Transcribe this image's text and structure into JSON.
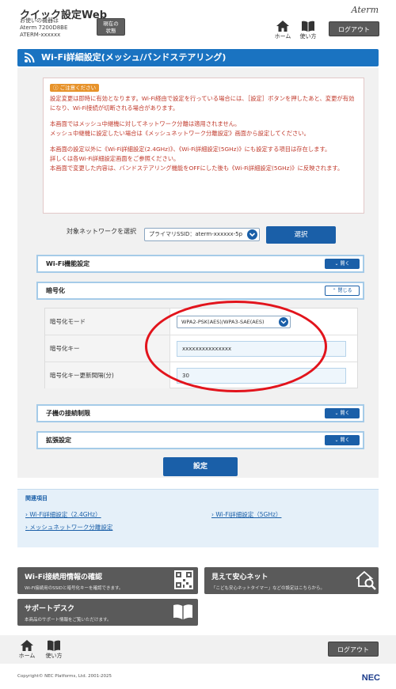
{
  "header": {
    "app_title": "クイック設定Web",
    "device_line1": "お使いの機器は",
    "device_line2": "Aterm 7200D8BE",
    "device_line3": "ATERM-xxxxxx",
    "status_button_line1": "現在の",
    "status_button_line2": "状態",
    "brand": "Aterm",
    "home_label": "ホーム",
    "manual_label": "使い方",
    "logout_label": "ログアウト"
  },
  "page_title": "Wi-Fi詳細設定(メッシュ/バンドステアリング)",
  "notice": {
    "badge": "ご注意ください",
    "p1": "設定変更は即時に有効となります。Wi-Fi経由で設定を行っている場合には、［設定］ボタンを押したあと、変更が有効になり、Wi-Fi接続が切断される場合があります。",
    "p2a": "本画面ではメッシュ中継機に対してネットワーク分離は適用されません。",
    "p2b": "メッシュ中継機に設定したい場合は《メッシュネットワーク分離設定》画面から設定してください。",
    "p3a": "本画面の設定以外に《Wi-Fi詳細設定(2.4GHz)》、《Wi-Fi詳細設定(5GHz)》にも設定する項目は存在します。",
    "p3b": "詳しくは各Wi-Fi詳細設定画面をご参照ください。",
    "p3c": "本画面で変更した内容は、バンドステアリング機能をOFFにした後も《Wi-Fi詳細設定(5GHz)》に反映されます。"
  },
  "network_select": {
    "label": "対象ネットワークを選択",
    "value": "プライマリSSID：aterm-xxxxxx-5p",
    "button": "選択"
  },
  "sections": {
    "wifi_function": {
      "title": "Wi-Fi機能設定",
      "toggle": "開く"
    },
    "encryption": {
      "title": "暗号化",
      "toggle": "閉じる"
    },
    "child_restriction": {
      "title": "子機の接続制限",
      "toggle": "開く"
    },
    "extended": {
      "title": "拡張設定",
      "toggle": "開く"
    }
  },
  "encryption": {
    "mode_label": "暗号化モード",
    "mode_value": "WPA2-PSK(AES)/WPA3-SAE(AES)",
    "key_label": "暗号化キー",
    "key_value": "xxxxxxxxxxxxxxx",
    "interval_label": "暗号化キー更新間隔(分)",
    "interval_value": "30"
  },
  "save_button": "設定",
  "related": {
    "title": "関連項目",
    "link1": "Wi-Fi詳細設定（2.4GHz）",
    "link2": "Wi-Fi詳細設定（5GHz）",
    "link3": "メッシュネットワーク分離設定"
  },
  "tiles": {
    "wifi_info_title": "Wi-Fi接続用情報の確認",
    "wifi_info_desc": "Wi-Fi接続用のSSIDと暗号化キーを確認できます。",
    "safety_title": "見えて安心ネット",
    "safety_desc": "「こども安心ネットタイマー」などの設定はこちらから。",
    "support_title": "サポートデスク",
    "support_desc": "本商品のサポート情報をご覧いただけます。"
  },
  "footer": {
    "home_label": "ホーム",
    "manual_label": "使い方",
    "logout_label": "ログアウト",
    "copyright": "Copyright© NEC Platforms, Ltd. 2001-2025",
    "nec": "NEC"
  },
  "colors": {
    "primary_blue": "#1a5fa8",
    "title_bar_blue": "#1a73c1",
    "notice_red": "#c0392b",
    "highlight_red": "#e2141c",
    "tile_gray": "#5a5a5a"
  }
}
